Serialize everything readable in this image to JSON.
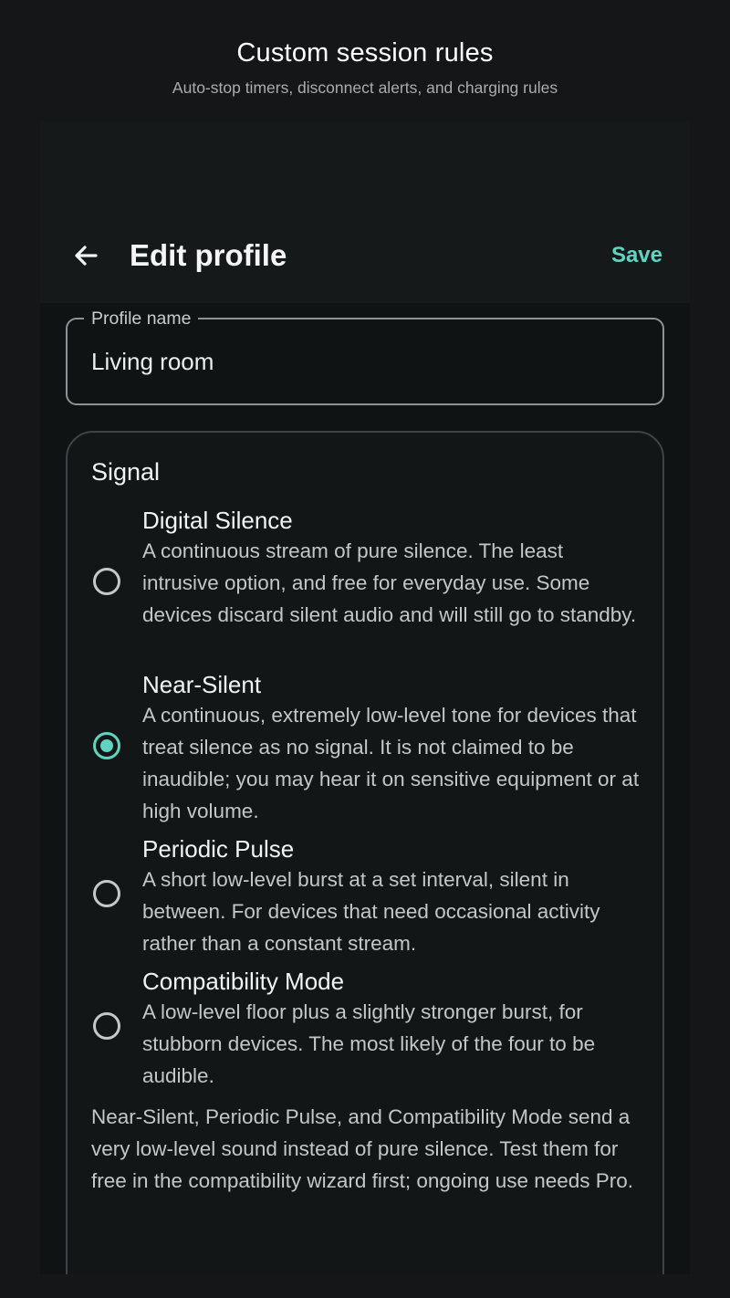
{
  "caption": {
    "title": "Custom session rules",
    "subtitle": "Auto-stop timers, disconnect alerts, and charging rules"
  },
  "app_bar": {
    "back_icon": "arrow-left-icon",
    "title": "Edit profile",
    "save_label": "Save"
  },
  "profile_name_field": {
    "label": "Profile name",
    "value": "Living room"
  },
  "signal": {
    "title": "Signal",
    "options": [
      {
        "name": "Digital Silence",
        "description": "A continuous stream of pure silence. The least intrusive option, and free for everyday use. Some devices discard silent audio and will still go to standby.",
        "selected": false
      },
      {
        "name": "Near-Silent",
        "description": "A continuous, extremely low-level tone for devices that treat silence as no signal. It is not claimed to be inaudible; you may hear it on sensitive equipment or at high volume.",
        "selected": true
      },
      {
        "name": "Periodic Pulse",
        "description": "A short low-level burst at a set interval, silent in between. For devices that need occasional activity rather than a constant stream.",
        "selected": false
      },
      {
        "name": "Compatibility Mode",
        "description": "A low-level floor plus a slightly stronger burst, for stubborn devices. The most likely of the four to be audible.",
        "selected": false
      }
    ],
    "footnote": "Near-Silent, Periodic Pulse, and Compatibility Mode send a very low-level sound instead of pure silence. Test them for free in the compatibility wizard first; ongoing use needs Pro."
  },
  "colors": {
    "accent": "#5fd4bf",
    "background": "#101314"
  }
}
